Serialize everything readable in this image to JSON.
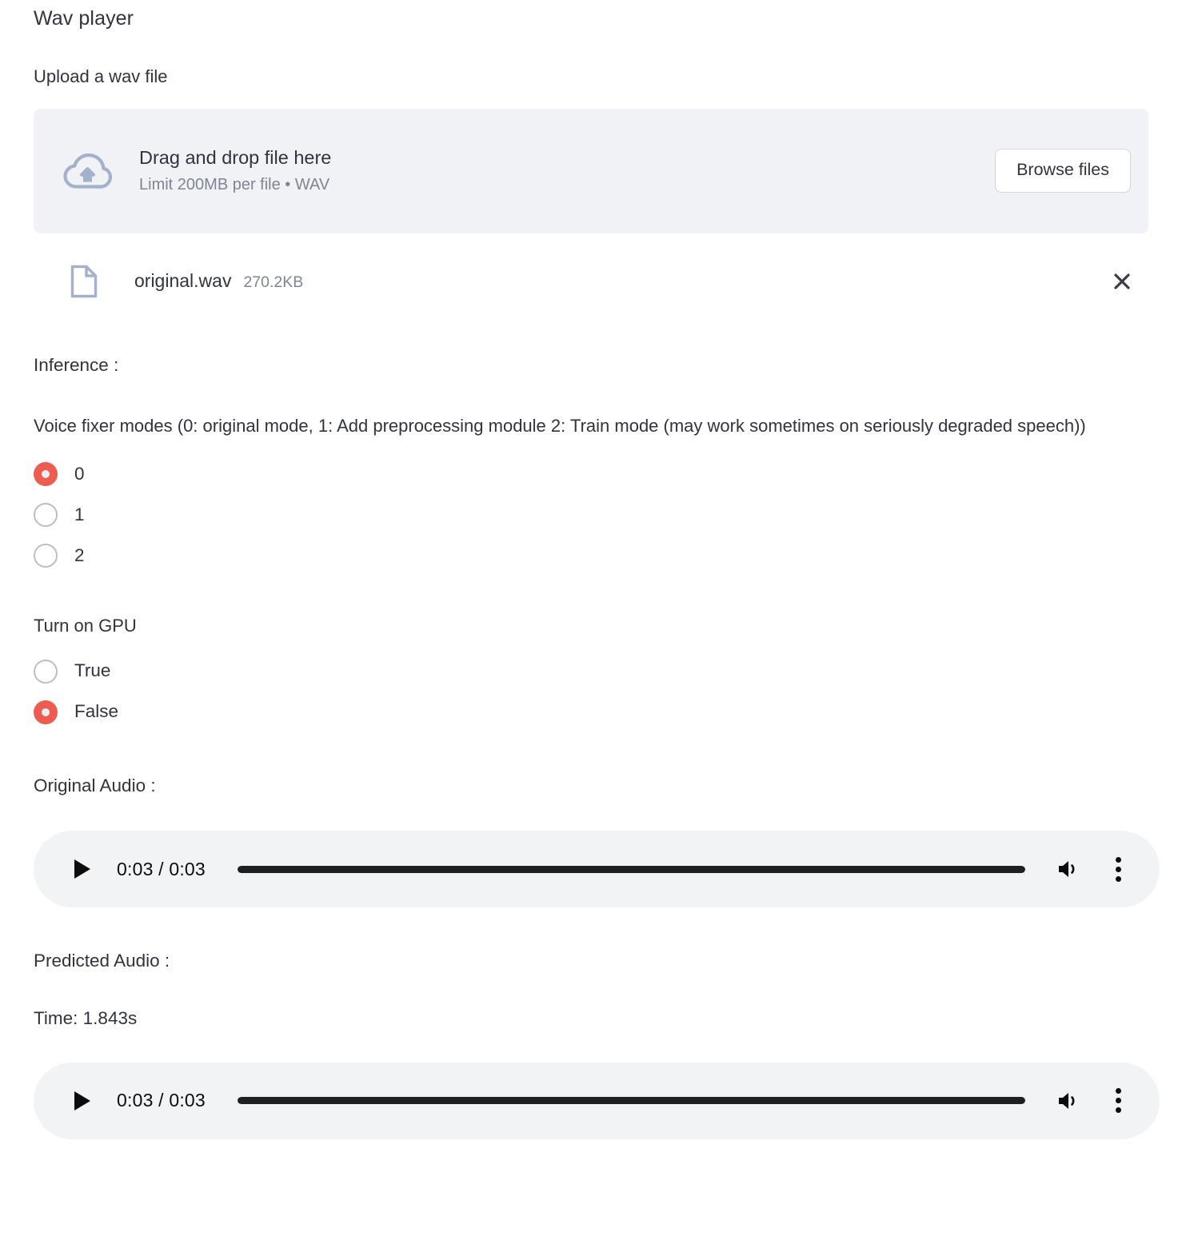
{
  "app": {
    "title": "Wav player"
  },
  "upload": {
    "label": "Upload a wav file",
    "cloud_icon": "cloud-upload-icon",
    "dropzone_title": "Drag and drop file here",
    "dropzone_limit": "Limit 200MB per file • WAV",
    "browse_label": "Browse files"
  },
  "uploaded_file": {
    "file_icon": "document-icon",
    "name": "original.wav",
    "size": "270.2KB",
    "remove_icon": "close-icon"
  },
  "inference": {
    "heading": "Inference :",
    "mode_description": "Voice fixer modes (0: original mode, 1: Add preprocessing module 2: Train mode (may work sometimes on seriously degraded speech))",
    "mode_options": [
      {
        "label": "0",
        "selected": true
      },
      {
        "label": "1",
        "selected": false
      },
      {
        "label": "2",
        "selected": false
      }
    ],
    "gpu_label": "Turn on GPU",
    "gpu_options": [
      {
        "label": "True",
        "selected": false
      },
      {
        "label": "False",
        "selected": true
      }
    ]
  },
  "original_audio": {
    "heading": "Original Audio :",
    "play_icon": "play-icon",
    "time": "0:03 / 0:03",
    "progress_percent": 100,
    "volume_icon": "volume-icon",
    "more_icon": "more-vertical-icon"
  },
  "predicted_audio": {
    "heading": "Predicted Audio :",
    "time_text": "Time: 1.843s",
    "play_icon": "play-icon",
    "time": "0:03 / 0:03",
    "progress_percent": 100,
    "volume_icon": "volume-icon",
    "more_icon": "more-vertical-icon"
  },
  "colors": {
    "accent": "#ee5b50",
    "surface": "#f0f2f6",
    "player_surface": "#f1f3f4",
    "text": "#31333f",
    "muted_text": "#808495",
    "icon_slate": "#a3b1cc"
  }
}
